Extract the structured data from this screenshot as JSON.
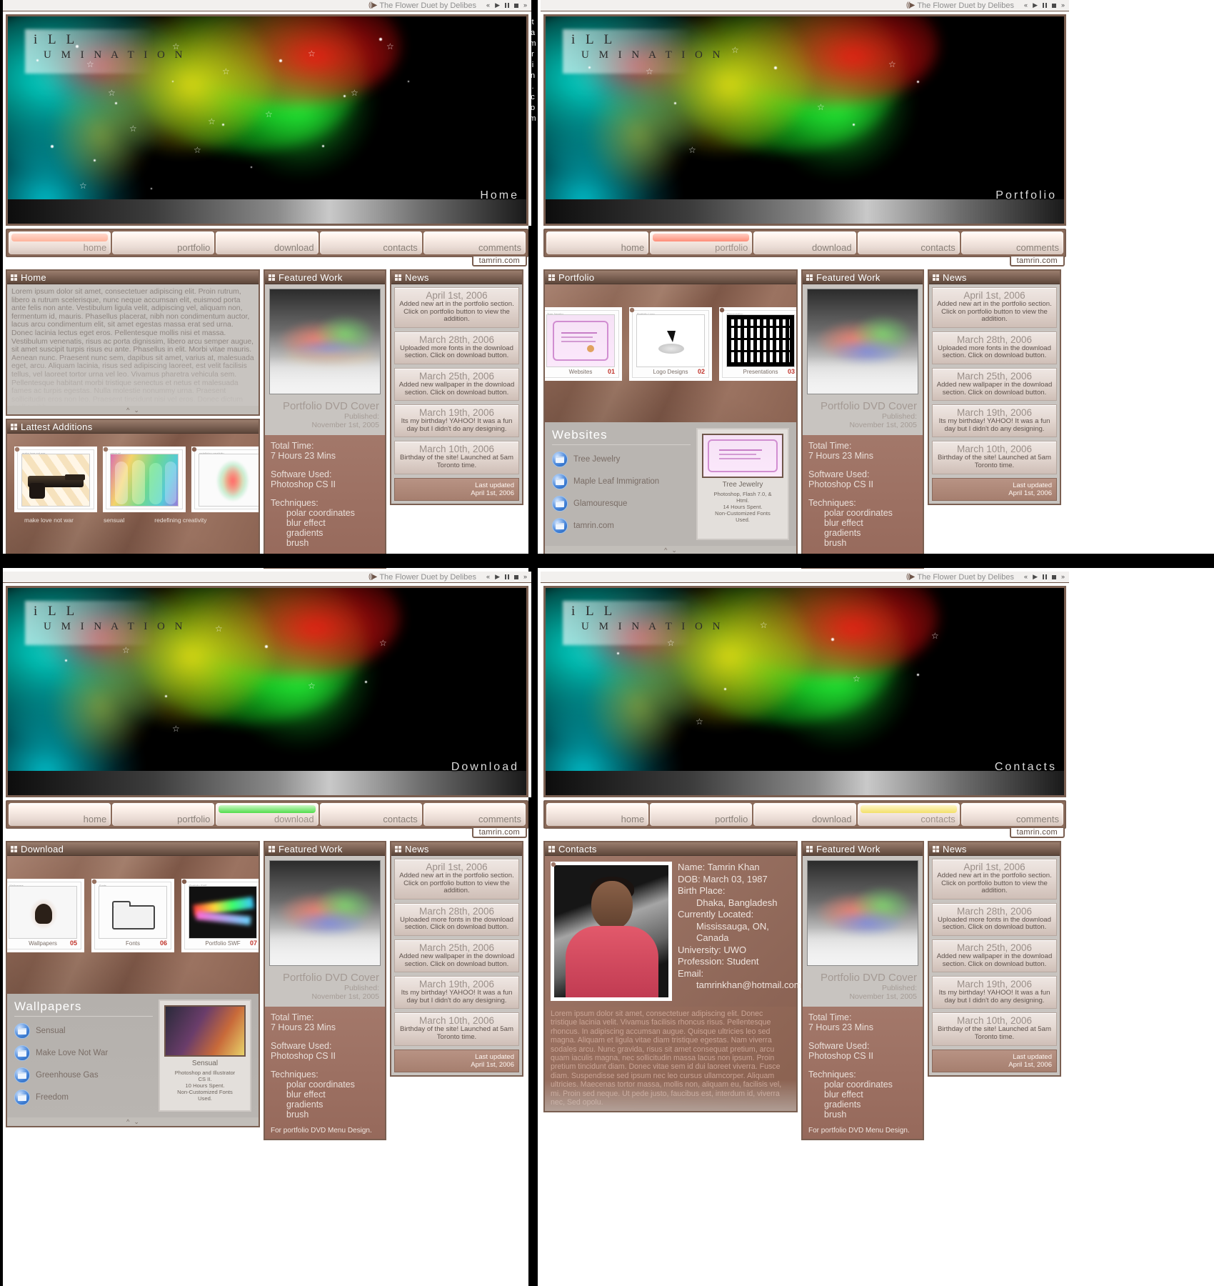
{
  "player": {
    "speaker_icon": "speaker-icon",
    "title": "The Flower Duet by Delibes",
    "prev_icon": "prev-icon",
    "play_icon": "play-icon",
    "pause_icon": "pause-icon",
    "stop_icon": "stop-icon",
    "next_icon": "next-icon"
  },
  "brand": {
    "logo_line1": "i L L",
    "logo_line2": "U M I N A T I O N",
    "chip": "tamrin.com",
    "vertical": "tamrin.com"
  },
  "nav": {
    "tabs": [
      {
        "label": "home"
      },
      {
        "label": "portfolio"
      },
      {
        "label": "download"
      },
      {
        "label": "contacts"
      },
      {
        "label": "comments"
      }
    ]
  },
  "pages": [
    {
      "id": "home",
      "hero_label": "Home",
      "active_index": 0
    },
    {
      "id": "portfolio",
      "hero_label": "Portfolio",
      "active_index": 1
    },
    {
      "id": "download",
      "hero_label": "Download",
      "active_index": 2
    },
    {
      "id": "contacts",
      "hero_label": "Contacts",
      "active_index": 3
    }
  ],
  "home": {
    "panel_title": "Home",
    "body": "Lorem ipsum dolor sit amet, consectetuer adipiscing elit. Proin rutrum, libero a rutrum scelerisque, nunc neque accumsan elit, euismod porta ante felis non ante. Vestibulum ligula velit, adipiscing vel, aliquam non, fermentum id, mauris. Phasellus placerat, nibh non condimentum auctor, lacus arcu condimentum elit, sit amet egestas massa erat sed urna. Donec lacinia lectus eget eros. Pellentesque mollis nisi et massa. Vestibulum venenatis, risus ac porta dignissim, libero arcu semper augue, sit amet suscipit turpis risus eu ante. Phasellus in elit. Morbi vitae mauris. Aenean nunc. Praesent nunc sem, dapibus sit amet, varius at, malesuada eget, arcu. Aliquam lacinia, risus sed adipiscing laoreet, est velit facilisis tellus, vel laoreet tortor urna vel leo. Vivamus pharetra vehicula sem. Pellentesque habitant morbi tristique senectus et netus et malesuada fames ac turpis egestas. Nulla molestie nonummy urna. Praesent sollicitudin eros non leo. Praesent tincidunt nisi vel eros. Donec dictum mollis nibh.",
    "additions_title": "Lattest Additions",
    "additions": [
      {
        "caption": "make love not war",
        "stamp_top": "make love not war"
      },
      {
        "caption": "sensual",
        "stamp_top": "sensual"
      },
      {
        "caption": "redefining creativity",
        "stamp_top": "redefining creativity"
      }
    ],
    "scroll_up_icon": "chevron-up-icon",
    "scroll_down_icon": "chevron-down-icon"
  },
  "portfolio": {
    "panel_title": "Portfolio",
    "stamps": [
      {
        "caption": "Websites",
        "num": "01",
        "top": "Tree Jewelry"
      },
      {
        "caption": "Logo Designs",
        "num": "02",
        "top": "Portfolio Logo"
      },
      {
        "caption": "Presentations",
        "num": "03",
        "top": "Presentation"
      }
    ],
    "section_title": "Websites",
    "links": [
      {
        "label": "Tree Jewelry"
      },
      {
        "label": "Maple Leaf Immigration"
      },
      {
        "label": "Glamouresque"
      },
      {
        "label": "tamrin.com"
      }
    ],
    "preview": {
      "caption": "Tree Jewelry",
      "desc_line1": "Photoshop, Flash 7.0, &",
      "desc_line2": "Html.",
      "desc_line3": "14 Hours Spent.",
      "desc_line4": "Non-Customized Fonts",
      "desc_line5": "Used."
    }
  },
  "download": {
    "panel_title": "Download",
    "stamps": [
      {
        "caption": "Wallpapers",
        "num": "05",
        "top": "Wallpapers"
      },
      {
        "caption": "Fonts",
        "num": "06",
        "top": "Fonts"
      },
      {
        "caption": "Portfolio SWF",
        "num": "07",
        "top": "Portfolio SWF"
      }
    ],
    "section_title": "Wallpapers",
    "links": [
      {
        "label": "Sensual"
      },
      {
        "label": "Make Love Not War"
      },
      {
        "label": "Greenhouse Gas"
      },
      {
        "label": "Freedom"
      }
    ],
    "preview": {
      "caption": "Sensual",
      "desc_line1": "Photoshop and Illustrator",
      "desc_line2": "CS II.",
      "desc_line3": "10 Hours Spent.",
      "desc_line4": "Non-Customized Fonts",
      "desc_line5": "Used."
    }
  },
  "contacts": {
    "panel_title": "Contacts",
    "name_label": "Name:",
    "name_value": "Tamrin Khan",
    "dob_label": "DOB:",
    "dob_value": "March 03, 1987",
    "birthplace_label": "Birth Place:",
    "birthplace_value": "Dhaka, Bangladesh",
    "located_label": "Currently Located:",
    "located_value": "Mississauga, ON, Canada",
    "university_label": "University:",
    "university_value": "UWO",
    "profession_label": "Profession:",
    "profession_value": "Student",
    "email_label": "Email:",
    "email_value": "tamrinkhan@hotmail.com",
    "body": "Lorem ipsum dolor sit amet, consectetuer adipiscing elit. Donec tristique lacinia velit. Vivamus facilisis rhoncus risus. Pellentesque rhoncus. In adipiscing accumsan augue. Quisque ultricies leo sed magna. Aliquam et ligula vitae diam tristique egestas. Nam viverra sodales arcu. Nunc gravida, risus sit amet consequat pretium, arcu quam iaculis magna, nec sollicitudin massa lacus non ipsum. Proin pretium tincidunt diam. Donec vitae sem id dui laoreet viverra. Fusce diam. Suspendisse sed ipsum nec leo cursus ullamcorper. Aliquam ultricies. Maecenas tortor massa, mollis non, aliquam eu, facilisis vel, mi. Proin sed neque. Ut pede justo, faucibus est, interdum id, viverra nec, Sed opolu."
  },
  "featured": {
    "panel_title": "Featured Work",
    "title": "Portfolio DVD Cover",
    "published_label": "Published:",
    "published_value": "November 1st, 2005",
    "total_time_label": "Total Time:",
    "total_time_value": "7 Hours 23 Mins",
    "software_label": "Software Used:",
    "software_value": "Photoshop CS II",
    "techniques_label": "Techniques:",
    "techniques": [
      "polar coordinates",
      "blur effect",
      "gradients",
      "brush"
    ],
    "footer": "For portfolio DVD Menu Design."
  },
  "news": {
    "panel_title": "News",
    "items": [
      {
        "date": "April 1st, 2006",
        "text": "Added new art in the portfolio section. Click on portfolio button to view the addition."
      },
      {
        "date": "March 28th, 2006",
        "text": "Uploaded more fonts in the download section. Click on download button."
      },
      {
        "date": "March 25th, 2006",
        "text": "Added new wallpaper in the download section. Click on download button."
      },
      {
        "date": "March 19th, 2006",
        "text": "Its my birthday! YAHOO! It was a fun day but I didn't do any designing."
      },
      {
        "date": "March 10th, 2006",
        "text": "Birthday of the site! Launched at 5am Toronto time."
      }
    ],
    "last_updated_label": "Last updated",
    "last_updated_value": "April 1st, 2006"
  },
  "colors": {
    "frame_brown": "#7a5f51",
    "panel_head_dark": "#5d463a",
    "accent_red": "#c1342b",
    "tab_active_home": "#ffb39c",
    "tab_active_portfolio": "#ff8d78",
    "tab_active_download": "#52dd4c",
    "tab_active_contacts": "#f3e06a"
  }
}
